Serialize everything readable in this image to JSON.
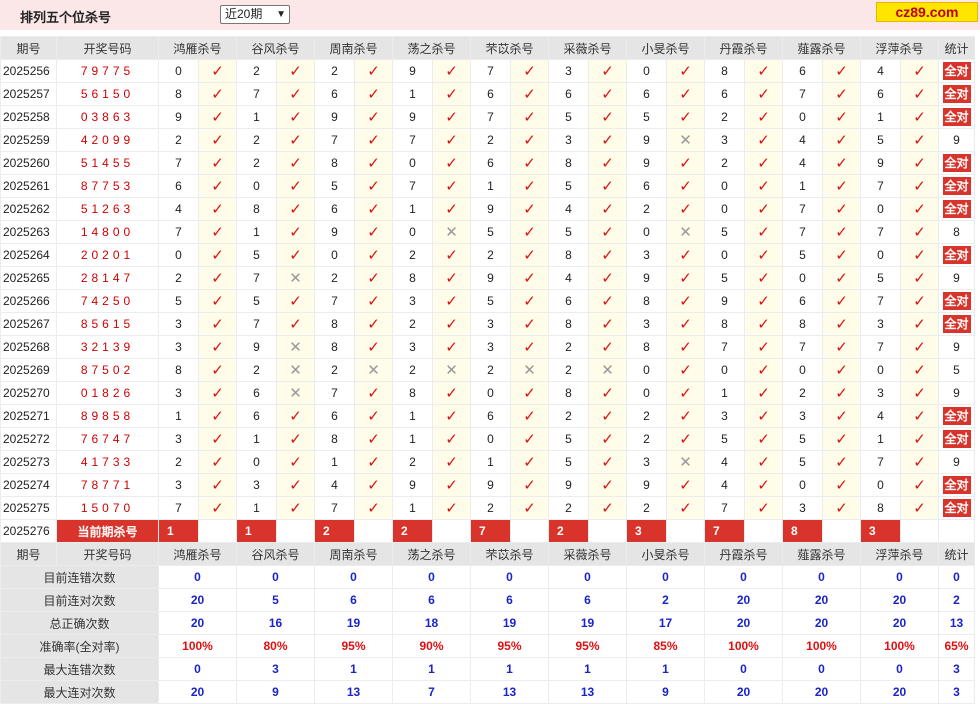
{
  "header": {
    "title": "排列五个位杀号",
    "period_select": "近20期",
    "brand": "cz89.com"
  },
  "columns": {
    "issue": "期号",
    "code": "开奖号码",
    "predictors": [
      "鸿雁杀号",
      "谷风杀号",
      "周南杀号",
      "荡之杀号",
      "芣苡杀号",
      "采薇杀号",
      "小旻杀号",
      "丹霞杀号",
      "薤露杀号",
      "浮萍杀号"
    ],
    "stat": "统计"
  },
  "rows": [
    {
      "issue": "2025256",
      "code": "79775",
      "kills": [
        "0",
        "2",
        "2",
        "9",
        "7",
        "3",
        "0",
        "8",
        "6",
        "4"
      ],
      "hits": [
        1,
        1,
        1,
        1,
        1,
        1,
        1,
        1,
        1,
        1
      ],
      "stat": "全对"
    },
    {
      "issue": "2025257",
      "code": "56150",
      "kills": [
        "8",
        "7",
        "6",
        "1",
        "6",
        "6",
        "6",
        "6",
        "7",
        "6"
      ],
      "hits": [
        1,
        1,
        1,
        1,
        1,
        1,
        1,
        1,
        1,
        1
      ],
      "stat": "全对"
    },
    {
      "issue": "2025258",
      "code": "03863",
      "kills": [
        "9",
        "1",
        "9",
        "9",
        "7",
        "5",
        "5",
        "2",
        "0",
        "1"
      ],
      "hits": [
        1,
        1,
        1,
        1,
        1,
        1,
        1,
        1,
        1,
        1
      ],
      "stat": "全对"
    },
    {
      "issue": "2025259",
      "code": "42099",
      "kills": [
        "2",
        "2",
        "7",
        "7",
        "2",
        "3",
        "9",
        "3",
        "4",
        "5"
      ],
      "hits": [
        1,
        1,
        1,
        1,
        1,
        1,
        0,
        1,
        1,
        1
      ],
      "stat": "9"
    },
    {
      "issue": "2025260",
      "code": "51455",
      "kills": [
        "7",
        "2",
        "8",
        "0",
        "6",
        "8",
        "9",
        "2",
        "4",
        "9"
      ],
      "hits": [
        1,
        1,
        1,
        1,
        1,
        1,
        1,
        1,
        1,
        1
      ],
      "stat": "全对"
    },
    {
      "issue": "2025261",
      "code": "87753",
      "kills": [
        "6",
        "0",
        "5",
        "7",
        "1",
        "5",
        "6",
        "0",
        "1",
        "7"
      ],
      "hits": [
        1,
        1,
        1,
        1,
        1,
        1,
        1,
        1,
        1,
        1
      ],
      "stat": "全对"
    },
    {
      "issue": "2025262",
      "code": "51263",
      "kills": [
        "4",
        "8",
        "6",
        "1",
        "9",
        "4",
        "2",
        "0",
        "7",
        "0"
      ],
      "hits": [
        1,
        1,
        1,
        1,
        1,
        1,
        1,
        1,
        1,
        1
      ],
      "stat": "全对"
    },
    {
      "issue": "2025263",
      "code": "14800",
      "kills": [
        "7",
        "1",
        "9",
        "0",
        "5",
        "5",
        "0",
        "5",
        "7",
        "7"
      ],
      "hits": [
        1,
        1,
        1,
        0,
        1,
        1,
        0,
        1,
        1,
        1
      ],
      "stat": "8"
    },
    {
      "issue": "2025264",
      "code": "20201",
      "kills": [
        "0",
        "5",
        "0",
        "2",
        "2",
        "8",
        "3",
        "0",
        "5",
        "0"
      ],
      "hits": [
        1,
        1,
        1,
        1,
        1,
        1,
        1,
        1,
        1,
        1
      ],
      "stat": "全对"
    },
    {
      "issue": "2025265",
      "code": "28147",
      "kills": [
        "2",
        "7",
        "2",
        "8",
        "9",
        "4",
        "9",
        "5",
        "0",
        "5"
      ],
      "hits": [
        1,
        0,
        1,
        1,
        1,
        1,
        1,
        1,
        1,
        1
      ],
      "stat": "9"
    },
    {
      "issue": "2025266",
      "code": "74250",
      "kills": [
        "5",
        "5",
        "7",
        "3",
        "5",
        "6",
        "8",
        "9",
        "6",
        "7"
      ],
      "hits": [
        1,
        1,
        1,
        1,
        1,
        1,
        1,
        1,
        1,
        1
      ],
      "stat": "全对"
    },
    {
      "issue": "2025267",
      "code": "85615",
      "kills": [
        "3",
        "7",
        "8",
        "2",
        "3",
        "8",
        "3",
        "8",
        "8",
        "3"
      ],
      "hits": [
        1,
        1,
        1,
        1,
        1,
        1,
        1,
        1,
        1,
        1
      ],
      "stat": "全对"
    },
    {
      "issue": "2025268",
      "code": "32139",
      "kills": [
        "3",
        "9",
        "8",
        "3",
        "3",
        "2",
        "8",
        "7",
        "7",
        "7"
      ],
      "hits": [
        1,
        0,
        1,
        1,
        1,
        1,
        1,
        1,
        1,
        1
      ],
      "stat": "9"
    },
    {
      "issue": "2025269",
      "code": "87502",
      "kills": [
        "8",
        "2",
        "2",
        "2",
        "2",
        "2",
        "0",
        "0",
        "0",
        "0"
      ],
      "hits": [
        1,
        0,
        0,
        0,
        0,
        0,
        1,
        1,
        1,
        1
      ],
      "stat": "5"
    },
    {
      "issue": "2025270",
      "code": "01826",
      "kills": [
        "3",
        "6",
        "7",
        "8",
        "0",
        "8",
        "0",
        "1",
        "2",
        "3"
      ],
      "hits": [
        1,
        0,
        1,
        1,
        1,
        1,
        1,
        1,
        1,
        1
      ],
      "stat": "9"
    },
    {
      "issue": "2025271",
      "code": "89858",
      "kills": [
        "1",
        "6",
        "6",
        "1",
        "6",
        "2",
        "2",
        "3",
        "3",
        "4"
      ],
      "hits": [
        1,
        1,
        1,
        1,
        1,
        1,
        1,
        1,
        1,
        1
      ],
      "stat": "全对"
    },
    {
      "issue": "2025272",
      "code": "76747",
      "kills": [
        "3",
        "1",
        "8",
        "1",
        "0",
        "5",
        "2",
        "5",
        "5",
        "1"
      ],
      "hits": [
        1,
        1,
        1,
        1,
        1,
        1,
        1,
        1,
        1,
        1
      ],
      "stat": "全对"
    },
    {
      "issue": "2025273",
      "code": "41733",
      "kills": [
        "2",
        "0",
        "1",
        "2",
        "1",
        "5",
        "3",
        "4",
        "5",
        "7"
      ],
      "hits": [
        1,
        1,
        1,
        1,
        1,
        1,
        0,
        1,
        1,
        1
      ],
      "stat": "9"
    },
    {
      "issue": "2025274",
      "code": "78771",
      "kills": [
        "3",
        "3",
        "4",
        "9",
        "9",
        "9",
        "9",
        "4",
        "0",
        "0"
      ],
      "hits": [
        1,
        1,
        1,
        1,
        1,
        1,
        1,
        1,
        1,
        1
      ],
      "stat": "全对"
    },
    {
      "issue": "2025275",
      "code": "15070",
      "kills": [
        "7",
        "1",
        "7",
        "1",
        "2",
        "2",
        "2",
        "7",
        "3",
        "8"
      ],
      "hits": [
        1,
        1,
        1,
        1,
        1,
        1,
        1,
        1,
        1,
        1
      ],
      "stat": "全对"
    }
  ],
  "current": {
    "issue": "2025276",
    "label": "当前期杀号",
    "kills": [
      "1",
      "1",
      "2",
      "2",
      "7",
      "2",
      "3",
      "7",
      "8",
      "3"
    ]
  },
  "stats": [
    {
      "label": "目前连错次数",
      "values": [
        "0",
        "0",
        "0",
        "0",
        "0",
        "0",
        "0",
        "0",
        "0",
        "0",
        "0"
      ],
      "color": "blue"
    },
    {
      "label": "目前连对次数",
      "values": [
        "20",
        "5",
        "6",
        "6",
        "6",
        "6",
        "2",
        "20",
        "20",
        "20",
        "2"
      ],
      "color": "blue"
    },
    {
      "label": "总正确次数",
      "values": [
        "20",
        "16",
        "19",
        "18",
        "19",
        "19",
        "17",
        "20",
        "20",
        "20",
        "13"
      ],
      "color": "blue"
    },
    {
      "label": "准确率(全对率)",
      "values": [
        "100%",
        "80%",
        "95%",
        "90%",
        "95%",
        "95%",
        "85%",
        "100%",
        "100%",
        "100%",
        "65%"
      ],
      "color": "red"
    },
    {
      "label": "最大连错次数",
      "values": [
        "0",
        "3",
        "1",
        "1",
        "1",
        "1",
        "1",
        "0",
        "0",
        "0",
        "3"
      ],
      "color": "blue"
    },
    {
      "label": "最大连对次数",
      "values": [
        "20",
        "9",
        "13",
        "7",
        "13",
        "13",
        "9",
        "20",
        "20",
        "20",
        "3"
      ],
      "color": "blue"
    }
  ],
  "colors": {
    "header_bg": "#e5e5e5",
    "accent_red": "#d9342b",
    "hit_red": "#e01010",
    "miss_gray": "#999999",
    "stat_blue": "#1a24c8",
    "topbar": "#fbe7e7"
  }
}
